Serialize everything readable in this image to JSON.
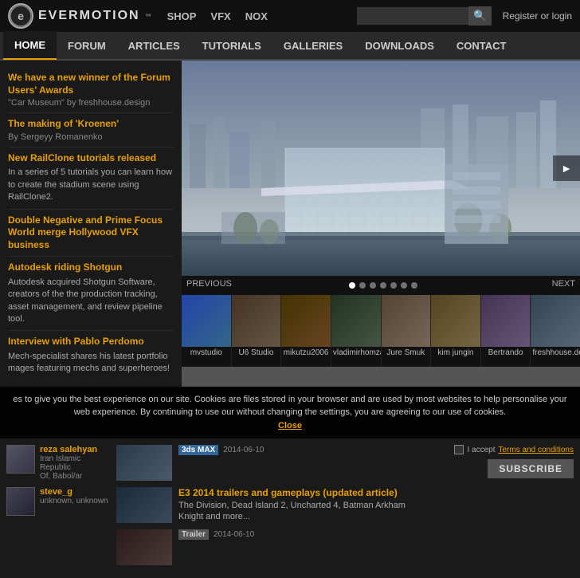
{
  "logo": {
    "symbol": "e",
    "name": "EVERMOTION",
    "tm": "™"
  },
  "top_nav": {
    "items": [
      "SHOP",
      "VFX",
      "NOX"
    ]
  },
  "search": {
    "placeholder": ""
  },
  "register": {
    "label": "Register or login"
  },
  "main_nav": {
    "items": [
      "HOME",
      "FORUM",
      "ARTICLES",
      "TUTORIALS",
      "GALLERIES",
      "DOWNLOADS",
      "CONTACT"
    ],
    "active": "HOME"
  },
  "sidebar": {
    "items": [
      {
        "title": "We have a new winner of the Forum Users' Awards",
        "subtitle": "\"Car Museum\" by freshhouse.design",
        "desc": ""
      },
      {
        "title": "The making of 'Kroenen'",
        "subtitle": "By Sergeyy Romanenko",
        "desc": ""
      },
      {
        "title": "New RailClone tutorials released",
        "subtitle": "",
        "desc": "In a series of 5 tutorials you can learn how to create the stadium scene using RailClone2."
      },
      {
        "title": "Double Negative and Prime Focus World merge Hollywood VFX business",
        "subtitle": "",
        "desc": ""
      },
      {
        "title": "Autodesk riding Shotgun",
        "subtitle": "",
        "desc": "Autodesk acquired Shotgun Software, creators of the the production tracking, asset management, and review pipeline tool."
      },
      {
        "title": "Interview with Pablo Perdomo",
        "subtitle": "",
        "desc": "Mech-specialist shares his latest portfolio mages featuring mechs and superheroes!"
      }
    ],
    "prev_label": "PREVIOUS",
    "next_label": "NEXT"
  },
  "thumbnails": [
    {
      "label": "mvstudio",
      "color1": "#2244aa",
      "color2": "#336688"
    },
    {
      "label": "U6 Studio",
      "color1": "#443322",
      "color2": "#665544"
    },
    {
      "label": "mikutzu2006",
      "color1": "#443300",
      "color2": "#664422"
    },
    {
      "label": "vladimirhomza",
      "color1": "#223322",
      "color2": "#445544"
    },
    {
      "label": "Jure Smuk",
      "color1": "#554433",
      "color2": "#776655"
    },
    {
      "label": "kim jungin",
      "color1": "#554422",
      "color2": "#776644"
    },
    {
      "label": "Bertrando",
      "color1": "#443355",
      "color2": "#665577"
    },
    {
      "label": "freshhouse.design",
      "color1": "#334455",
      "color2": "#556677"
    }
  ],
  "cookie": {
    "text": "es to give you the best experience on our site. Cookies are files stored in your browser and are used by most websites to help personalise your web experience. By continuing to use our without changing the settings, you are agreeing to our use of cookies.",
    "close_label": "Close"
  },
  "users": [
    {
      "name": "reza salehyan",
      "detail1": "Iran Islamic Republic",
      "detail2": "Of, Babol/ar"
    },
    {
      "name": "steve_g",
      "detail1": "unknown, unknown",
      "detail2": ""
    }
  ],
  "articles": [
    {
      "tag": "3ds MAX",
      "tag_type": "blue",
      "date": "2014-06-10",
      "title": "",
      "desc": "",
      "thumb_color": "#2a3a4a"
    },
    {
      "tag": "E3 2014 trailers and gameplays (updated article)",
      "tag_type": "",
      "date": "",
      "title": "E3 2014 trailers and gameplays (updated article)",
      "desc": "The Division, Dead Island 2, Uncharted 4, Batman Arkham Knight and more...",
      "thumb_color": "#2a2a3a"
    },
    {
      "tag": "Trailer",
      "tag_type": "",
      "date": "2014-06-10",
      "title": "",
      "desc": "",
      "thumb_color": "#3a2a2a"
    }
  ],
  "subscribe": {
    "check_label": "I accept",
    "link_label": "Terms and conditions",
    "button_label": "SUBSCRIBE"
  }
}
